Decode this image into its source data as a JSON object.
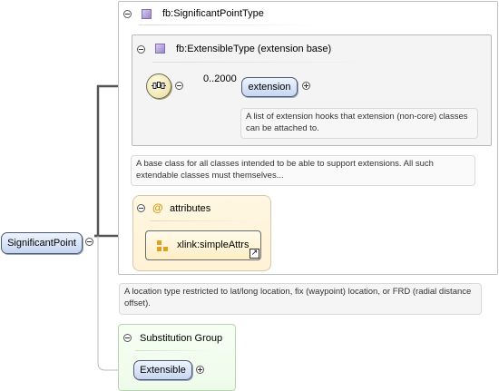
{
  "root_element": {
    "name": "SignificantPoint"
  },
  "significant_point_type": {
    "title": "fb:SignificantPointType",
    "documentation": "A location type restricted to lat/long location, fix (waypoint) location, or FRD (radial distance offset)."
  },
  "extensible_type": {
    "title": "fb:ExtensibleType (extension base)",
    "documentation": "A base class for all classes intended to be able to support extensions. All such extendable classes must themselves..."
  },
  "extension_element": {
    "name": "extension",
    "cardinality": "0..2000",
    "documentation": "A list of extension hooks that extension (non-core) classes can be attached to."
  },
  "attributes_group": {
    "title": "attributes",
    "items": [
      {
        "name": "xlink:simpleAttrs"
      }
    ]
  },
  "substitution_group": {
    "title": "Substitution Group",
    "member": {
      "name": "Extensible"
    }
  },
  "icons": {
    "type": "complex-type-icon",
    "sequence": "sequence-compositor-icon",
    "attribute": "attribute-group-icon",
    "link": "link-arrow-icon"
  }
}
